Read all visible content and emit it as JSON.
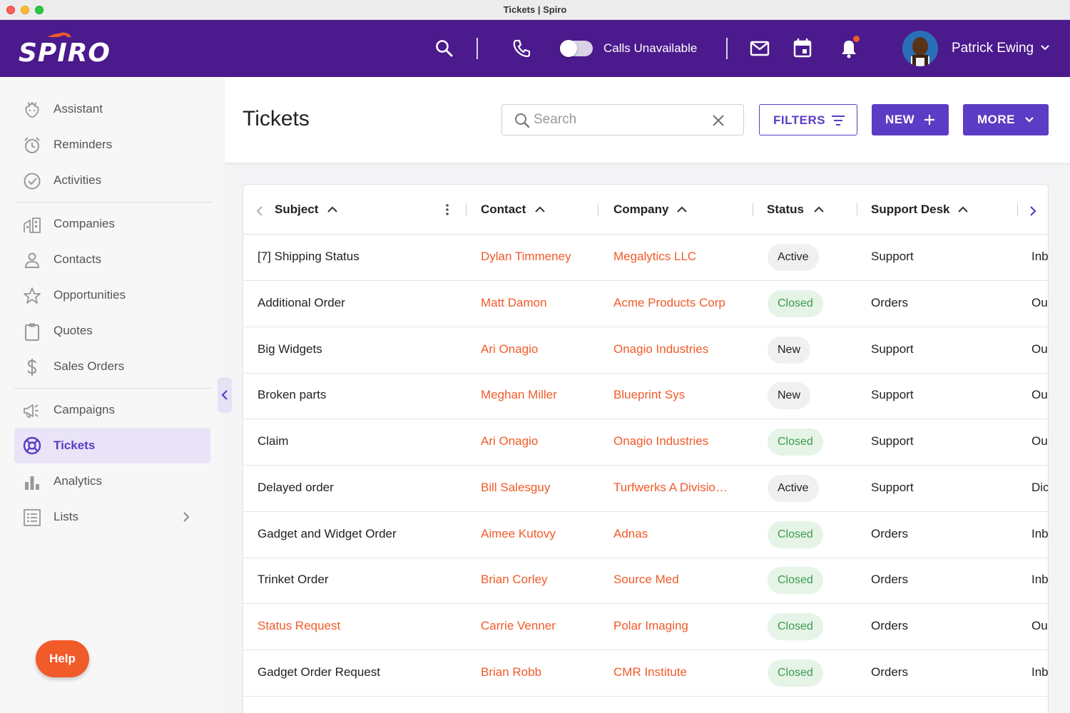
{
  "window": {
    "title": "Tickets | Spiro"
  },
  "header": {
    "logo": "SPIRO",
    "calls_status": "Calls Unavailable",
    "user_name": "Patrick Ewing"
  },
  "sidebar": {
    "items": [
      {
        "label": "Assistant",
        "icon": "assistant-icon"
      },
      {
        "label": "Reminders",
        "icon": "alarm-clock-icon"
      },
      {
        "label": "Activities",
        "icon": "check-circle-icon"
      },
      {
        "label": "Companies",
        "icon": "building-icon"
      },
      {
        "label": "Contacts",
        "icon": "person-icon"
      },
      {
        "label": "Opportunities",
        "icon": "star-icon"
      },
      {
        "label": "Quotes",
        "icon": "clipboard-icon"
      },
      {
        "label": "Sales Orders",
        "icon": "dollar-icon"
      },
      {
        "label": "Campaigns",
        "icon": "megaphone-icon"
      },
      {
        "label": "Tickets",
        "icon": "lifebuoy-icon",
        "active": true
      },
      {
        "label": "Analytics",
        "icon": "bar-chart-icon"
      },
      {
        "label": "Lists",
        "icon": "list-icon"
      }
    ],
    "help_label": "Help"
  },
  "page": {
    "title": "Tickets",
    "search_placeholder": "Search",
    "filters_label": "FILTERS",
    "new_label": "NEW",
    "more_label": "MORE"
  },
  "table": {
    "columns": [
      "Subject",
      "Contact",
      "Company",
      "Status",
      "Support Desk"
    ],
    "rows": [
      {
        "subject": "[7] Shipping Status",
        "contact": "Dylan Timmeney",
        "company": "Megalytics LLC",
        "status": "Active",
        "desk": "Support",
        "extra": "Inb"
      },
      {
        "subject": "Additional Order",
        "contact": "Matt Damon",
        "company": "Acme Products Corp",
        "status": "Closed",
        "desk": "Orders",
        "extra": "Ou"
      },
      {
        "subject": "Big Widgets",
        "contact": "Ari Onagio",
        "company": "Onagio Industries",
        "status": "New",
        "desk": "Support",
        "extra": "Ou"
      },
      {
        "subject": "Broken parts",
        "contact": "Meghan Miller",
        "company": "Blueprint Sys",
        "status": "New",
        "desk": "Support",
        "extra": "Ou"
      },
      {
        "subject": "Claim",
        "contact": "Ari Onagio",
        "company": "Onagio Industries",
        "status": "Closed",
        "desk": "Support",
        "extra": "Ou"
      },
      {
        "subject": "Delayed order",
        "contact": "Bill Salesguy",
        "company": "Turfwerks A Divisio…",
        "status": "Active",
        "desk": "Support",
        "extra": "Dic"
      },
      {
        "subject": "Gadget and Widget Order",
        "contact": "Aimee Kutovy",
        "company": "Adnas",
        "status": "Closed",
        "desk": "Orders",
        "extra": "Inb"
      },
      {
        "subject": "Trinket Order",
        "contact": "Brian Corley",
        "company": "Source Med",
        "status": "Closed",
        "desk": "Orders",
        "extra": "Inb"
      },
      {
        "subject": "Status Request",
        "contact": "Carrie Venner",
        "company": "Polar Imaging",
        "status": "Closed",
        "desk": "Orders",
        "extra": "Ou",
        "subject_link": true
      },
      {
        "subject": "Gadget Order Request",
        "contact": "Brian Robb",
        "company": "CMR Institute",
        "status": "Closed",
        "desk": "Orders",
        "extra": "Inb"
      }
    ]
  },
  "colors": {
    "brand_purple": "#4b1a8c",
    "accent_purple": "#5b3cc4",
    "link_orange": "#f15a29",
    "closed_green": "#3d9a4e"
  }
}
